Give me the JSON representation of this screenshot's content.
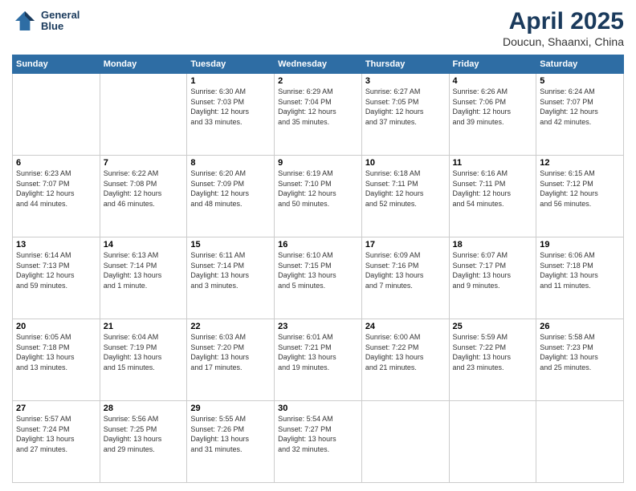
{
  "header": {
    "logo_line1": "General",
    "logo_line2": "Blue",
    "month": "April 2025",
    "location": "Doucun, Shaanxi, China"
  },
  "weekdays": [
    "Sunday",
    "Monday",
    "Tuesday",
    "Wednesday",
    "Thursday",
    "Friday",
    "Saturday"
  ],
  "weeks": [
    [
      {
        "day": "",
        "info": ""
      },
      {
        "day": "",
        "info": ""
      },
      {
        "day": "1",
        "info": "Sunrise: 6:30 AM\nSunset: 7:03 PM\nDaylight: 12 hours\nand 33 minutes."
      },
      {
        "day": "2",
        "info": "Sunrise: 6:29 AM\nSunset: 7:04 PM\nDaylight: 12 hours\nand 35 minutes."
      },
      {
        "day": "3",
        "info": "Sunrise: 6:27 AM\nSunset: 7:05 PM\nDaylight: 12 hours\nand 37 minutes."
      },
      {
        "day": "4",
        "info": "Sunrise: 6:26 AM\nSunset: 7:06 PM\nDaylight: 12 hours\nand 39 minutes."
      },
      {
        "day": "5",
        "info": "Sunrise: 6:24 AM\nSunset: 7:07 PM\nDaylight: 12 hours\nand 42 minutes."
      }
    ],
    [
      {
        "day": "6",
        "info": "Sunrise: 6:23 AM\nSunset: 7:07 PM\nDaylight: 12 hours\nand 44 minutes."
      },
      {
        "day": "7",
        "info": "Sunrise: 6:22 AM\nSunset: 7:08 PM\nDaylight: 12 hours\nand 46 minutes."
      },
      {
        "day": "8",
        "info": "Sunrise: 6:20 AM\nSunset: 7:09 PM\nDaylight: 12 hours\nand 48 minutes."
      },
      {
        "day": "9",
        "info": "Sunrise: 6:19 AM\nSunset: 7:10 PM\nDaylight: 12 hours\nand 50 minutes."
      },
      {
        "day": "10",
        "info": "Sunrise: 6:18 AM\nSunset: 7:11 PM\nDaylight: 12 hours\nand 52 minutes."
      },
      {
        "day": "11",
        "info": "Sunrise: 6:16 AM\nSunset: 7:11 PM\nDaylight: 12 hours\nand 54 minutes."
      },
      {
        "day": "12",
        "info": "Sunrise: 6:15 AM\nSunset: 7:12 PM\nDaylight: 12 hours\nand 56 minutes."
      }
    ],
    [
      {
        "day": "13",
        "info": "Sunrise: 6:14 AM\nSunset: 7:13 PM\nDaylight: 12 hours\nand 59 minutes."
      },
      {
        "day": "14",
        "info": "Sunrise: 6:13 AM\nSunset: 7:14 PM\nDaylight: 13 hours\nand 1 minute."
      },
      {
        "day": "15",
        "info": "Sunrise: 6:11 AM\nSunset: 7:14 PM\nDaylight: 13 hours\nand 3 minutes."
      },
      {
        "day": "16",
        "info": "Sunrise: 6:10 AM\nSunset: 7:15 PM\nDaylight: 13 hours\nand 5 minutes."
      },
      {
        "day": "17",
        "info": "Sunrise: 6:09 AM\nSunset: 7:16 PM\nDaylight: 13 hours\nand 7 minutes."
      },
      {
        "day": "18",
        "info": "Sunrise: 6:07 AM\nSunset: 7:17 PM\nDaylight: 13 hours\nand 9 minutes."
      },
      {
        "day": "19",
        "info": "Sunrise: 6:06 AM\nSunset: 7:18 PM\nDaylight: 13 hours\nand 11 minutes."
      }
    ],
    [
      {
        "day": "20",
        "info": "Sunrise: 6:05 AM\nSunset: 7:18 PM\nDaylight: 13 hours\nand 13 minutes."
      },
      {
        "day": "21",
        "info": "Sunrise: 6:04 AM\nSunset: 7:19 PM\nDaylight: 13 hours\nand 15 minutes."
      },
      {
        "day": "22",
        "info": "Sunrise: 6:03 AM\nSunset: 7:20 PM\nDaylight: 13 hours\nand 17 minutes."
      },
      {
        "day": "23",
        "info": "Sunrise: 6:01 AM\nSunset: 7:21 PM\nDaylight: 13 hours\nand 19 minutes."
      },
      {
        "day": "24",
        "info": "Sunrise: 6:00 AM\nSunset: 7:22 PM\nDaylight: 13 hours\nand 21 minutes."
      },
      {
        "day": "25",
        "info": "Sunrise: 5:59 AM\nSunset: 7:22 PM\nDaylight: 13 hours\nand 23 minutes."
      },
      {
        "day": "26",
        "info": "Sunrise: 5:58 AM\nSunset: 7:23 PM\nDaylight: 13 hours\nand 25 minutes."
      }
    ],
    [
      {
        "day": "27",
        "info": "Sunrise: 5:57 AM\nSunset: 7:24 PM\nDaylight: 13 hours\nand 27 minutes."
      },
      {
        "day": "28",
        "info": "Sunrise: 5:56 AM\nSunset: 7:25 PM\nDaylight: 13 hours\nand 29 minutes."
      },
      {
        "day": "29",
        "info": "Sunrise: 5:55 AM\nSunset: 7:26 PM\nDaylight: 13 hours\nand 31 minutes."
      },
      {
        "day": "30",
        "info": "Sunrise: 5:54 AM\nSunset: 7:27 PM\nDaylight: 13 hours\nand 32 minutes."
      },
      {
        "day": "",
        "info": ""
      },
      {
        "day": "",
        "info": ""
      },
      {
        "day": "",
        "info": ""
      }
    ]
  ]
}
